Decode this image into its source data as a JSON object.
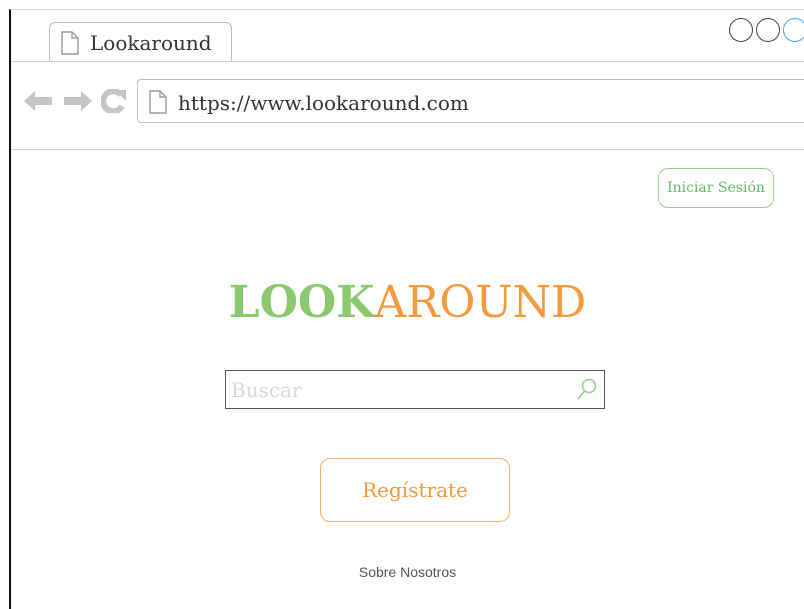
{
  "browser": {
    "tab": {
      "title": "Lookaround",
      "icon": "document-icon"
    },
    "window_controls": [
      "circle-icon",
      "circle-icon",
      "circle-icon"
    ],
    "nav": {
      "back_icon": "arrow-left-icon",
      "forward_icon": "arrow-right-icon",
      "reload_icon": "reload-icon"
    },
    "address_bar": {
      "icon": "document-icon",
      "url": "https://www.lookaround.com"
    }
  },
  "page": {
    "login_label": "Iniciar Sesión",
    "logo": {
      "part1": "LOOK",
      "part2": "AROUND"
    },
    "search": {
      "placeholder": "Buscar",
      "value": "",
      "icon": "search-icon"
    },
    "register_label": "Regístrate",
    "about_label": "Sobre Nosotros"
  },
  "colors": {
    "logo_green": "#8bc96e",
    "logo_orange": "#f59a3c",
    "login_border": "#8fd18f",
    "register_border": "#f5b06a",
    "window_control_accent": "#43a5f5",
    "nav_icon": "#c4c4c4"
  }
}
